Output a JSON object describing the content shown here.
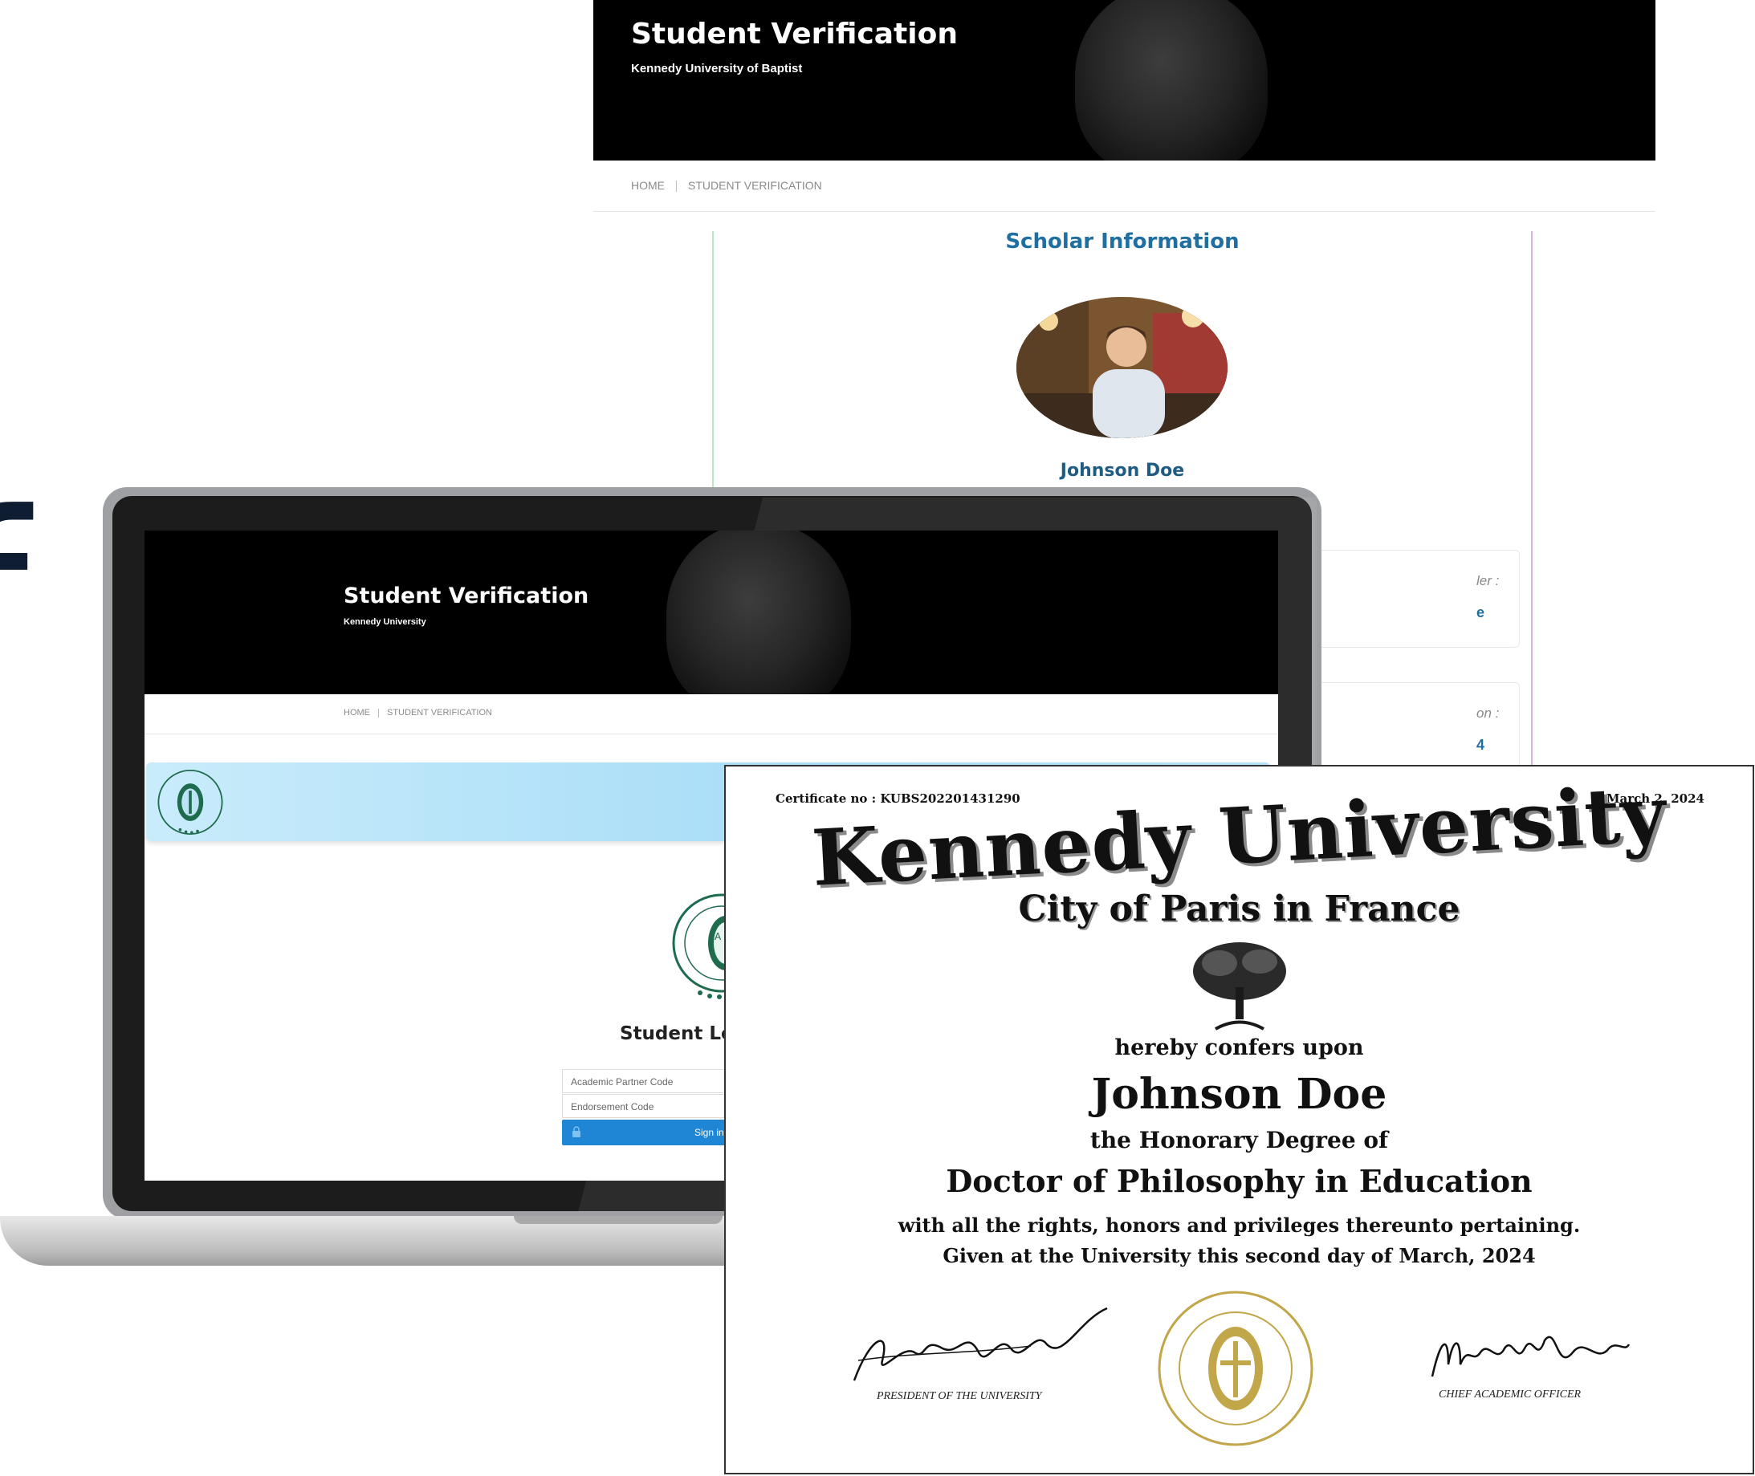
{
  "fragment_letter": "f",
  "back_window": {
    "title": "Student Verification",
    "subtitle": "Kennedy University of Baptist",
    "breadcrumb": [
      "HOME",
      "STUDENT VERIFICATION"
    ],
    "section_title": "Scholar Information",
    "scholar_name": "Johnson Doe",
    "fields": [
      {
        "label": "ler :",
        "value": "e"
      },
      {
        "label": "on :",
        "value": "4"
      }
    ]
  },
  "laptop_screen": {
    "title": "Student Verification",
    "subtitle": "Kennedy University",
    "breadcrumb": [
      "HOME",
      "STUDENT VERIFICATION"
    ],
    "login_title": "Student Log",
    "inputs": {
      "partner_code_placeholder": "Academic Partner Code",
      "endorsement_code_placeholder": "Endorsement Code"
    },
    "signin_label": "Sign in"
  },
  "certificate": {
    "number_line": "Certificate no : KUBS202201431290",
    "date": "March 2, 2024",
    "university": "Kennedy University",
    "city_line": "City of Paris in France",
    "confers": "hereby confers upon",
    "recipient": "Johnson Doe",
    "honorary_line": "the Honorary Degree of",
    "degree": "Doctor of Philosophy in Education",
    "rights_line": "with all the rights, honors and privileges thereunto pertaining.",
    "given_line": "Given at the University this second day of March, 2024",
    "signatures": [
      {
        "title": "PRESIDENT OF THE UNIVERSITY"
      },
      {
        "title": "CHIEF ACADEMIC OFFICER"
      }
    ]
  },
  "colors": {
    "hero_bg": "#000000",
    "accent_blue": "#1f6fa0",
    "signin_blue": "#1f86d6",
    "seal_gold": "#c2a64a",
    "logo_green": "#1e6b4e"
  }
}
